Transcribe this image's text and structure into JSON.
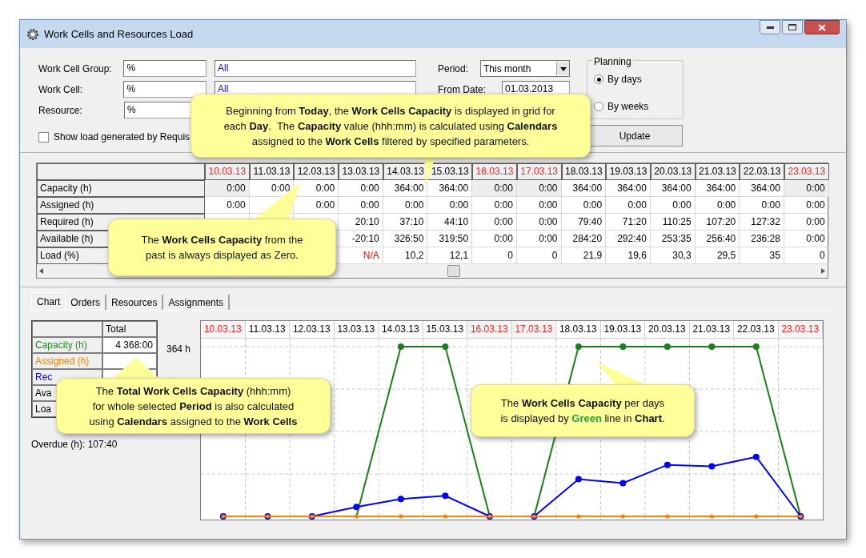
{
  "window": {
    "title": "Work Cells and Resources Load"
  },
  "filters": [
    {
      "label": "Work Cell Group:",
      "code": "%",
      "name": "All"
    },
    {
      "label": "Work Cell:",
      "code": "%",
      "name": "All"
    },
    {
      "label": "Resource:",
      "code": "%"
    }
  ],
  "requisitions_checkbox": {
    "label": "Show load generated by Requis",
    "checked": false
  },
  "period": {
    "label": "Period:",
    "value": "This month"
  },
  "from_date": {
    "label": "From Date:",
    "value": "01.03.2013"
  },
  "planning": {
    "title": "Planning",
    "options": [
      {
        "label": "By days",
        "selected": true
      },
      {
        "label": "By weeks",
        "selected": false
      }
    ]
  },
  "update_button": "Update",
  "grid": {
    "dates": [
      {
        "label": "10.03.13",
        "weekend": true
      },
      {
        "label": "11.03.13",
        "weekend": false
      },
      {
        "label": "12.03.13",
        "weekend": false
      },
      {
        "label": "13.03.13",
        "weekend": false
      },
      {
        "label": "14.03.13",
        "weekend": false
      },
      {
        "label": "15.03.13",
        "weekend": false
      },
      {
        "label": "16.03.13",
        "weekend": true
      },
      {
        "label": "17.03.13",
        "weekend": true
      },
      {
        "label": "18.03.13",
        "weekend": false
      },
      {
        "label": "19.03.13",
        "weekend": false
      },
      {
        "label": "20.03.13",
        "weekend": false
      },
      {
        "label": "21.03.13",
        "weekend": false
      },
      {
        "label": "22.03.13",
        "weekend": false
      },
      {
        "label": "23.03.13",
        "weekend": true
      }
    ],
    "rows": [
      {
        "label": "Capacity (h)",
        "cells": [
          {
            "text": "0:00",
            "alert": false
          },
          {
            "text": "0:00",
            "alert": false
          },
          {
            "text": "0:00",
            "alert": false
          },
          {
            "text": "0:00",
            "alert": false
          },
          {
            "text": "364:00",
            "alert": false
          },
          {
            "text": "364:00",
            "alert": false
          },
          {
            "text": "0:00",
            "alert": false
          },
          {
            "text": "0:00",
            "alert": false
          },
          {
            "text": "364:00",
            "alert": false
          },
          {
            "text": "364:00",
            "alert": false
          },
          {
            "text": "364:00",
            "alert": false
          },
          {
            "text": "364:00",
            "alert": false
          },
          {
            "text": "364:00",
            "alert": false
          },
          {
            "text": "0:00",
            "alert": false
          }
        ]
      },
      {
        "label": "Assigned (h)",
        "cells": [
          {
            "text": "0:00",
            "alert": false
          },
          null,
          {
            "text": "0:00",
            "alert": false
          },
          {
            "text": "0:00",
            "alert": false
          },
          {
            "text": "0:00",
            "alert": false
          },
          {
            "text": "0:00",
            "alert": false
          },
          {
            "text": "0:00",
            "alert": false
          },
          {
            "text": "0:00",
            "alert": false
          },
          {
            "text": "0:00",
            "alert": false
          },
          {
            "text": "0:00",
            "alert": false
          },
          {
            "text": "0:00",
            "alert": false
          },
          {
            "text": "0:00",
            "alert": false
          },
          {
            "text": "0:00",
            "alert": false
          },
          {
            "text": "0:00",
            "alert": false
          }
        ]
      },
      {
        "label": "Required (h)",
        "cells": [
          null,
          null,
          null,
          {
            "text": "20:10",
            "alert": false
          },
          {
            "text": "37:10",
            "alert": false
          },
          {
            "text": "44:10",
            "alert": false
          },
          {
            "text": "0:00",
            "alert": false
          },
          {
            "text": "0:00",
            "alert": false
          },
          {
            "text": "79:40",
            "alert": false
          },
          {
            "text": "71:20",
            "alert": false
          },
          {
            "text": "110:25",
            "alert": false
          },
          {
            "text": "107:20",
            "alert": false
          },
          {
            "text": "127:32",
            "alert": false
          },
          {
            "text": "0:00",
            "alert": false
          }
        ]
      },
      {
        "label": "Available (h)",
        "cells": [
          null,
          null,
          null,
          {
            "text": "-20:10",
            "alert": false
          },
          {
            "text": "326:50",
            "alert": false
          },
          {
            "text": "319:50",
            "alert": false
          },
          {
            "text": "0:00",
            "alert": false
          },
          {
            "text": "0:00",
            "alert": false
          },
          {
            "text": "284:20",
            "alert": false
          },
          {
            "text": "292:40",
            "alert": false
          },
          {
            "text": "253:35",
            "alert": false
          },
          {
            "text": "256:40",
            "alert": false
          },
          {
            "text": "236:28",
            "alert": false
          },
          {
            "text": "0:00",
            "alert": false
          }
        ]
      },
      {
        "label": "Load (%)",
        "cells": [
          null,
          null,
          null,
          {
            "text": "N/A",
            "alert": true
          },
          {
            "text": "10,2",
            "alert": false
          },
          {
            "text": "12,1",
            "alert": false
          },
          {
            "text": "0",
            "alert": false
          },
          {
            "text": "0",
            "alert": false
          },
          {
            "text": "21,9",
            "alert": false
          },
          {
            "text": "19,6",
            "alert": false
          },
          {
            "text": "30,3",
            "alert": false
          },
          {
            "text": "29,5",
            "alert": false
          },
          {
            "text": "35",
            "alert": false
          },
          {
            "text": "0",
            "alert": false
          }
        ]
      }
    ]
  },
  "tabs": [
    {
      "label": "Chart",
      "selected": true
    },
    {
      "label": "Orders",
      "selected": false
    },
    {
      "label": "Resources",
      "selected": false
    },
    {
      "label": "Assignments",
      "selected": false
    }
  ],
  "totals": {
    "header": "Total",
    "rows": [
      {
        "label": "Capacity (h)",
        "value": "4 368:00",
        "color": "#228b22"
      },
      {
        "label": "Assigned (h)",
        "color": "#ff8000"
      },
      {
        "label": "Rec",
        "color": "#0000ff"
      },
      {
        "label": "Ava",
        "color": "#000000"
      },
      {
        "label": "Loa",
        "color": "#000000"
      }
    ]
  },
  "axis_top_label": "364 h",
  "overdue": "Overdue (h): 107:40",
  "chart": {
    "dates": [
      {
        "label": "10.03.13",
        "weekend": true
      },
      {
        "label": "11.03.13",
        "weekend": false
      },
      {
        "label": "12.03.13",
        "weekend": false
      },
      {
        "label": "13.03.13",
        "weekend": false
      },
      {
        "label": "14.03.13",
        "weekend": false
      },
      {
        "label": "15.03.13",
        "weekend": false
      },
      {
        "label": "16.03.13",
        "weekend": true
      },
      {
        "label": "17.03.13",
        "weekend": true
      },
      {
        "label": "18.03.13",
        "weekend": false
      },
      {
        "label": "19.03.13",
        "weekend": false
      },
      {
        "label": "20.03.13",
        "weekend": false
      },
      {
        "label": "21.03.13",
        "weekend": false
      },
      {
        "label": "22.03.13",
        "weekend": false
      },
      {
        "label": "23.03.13",
        "weekend": true
      }
    ]
  },
  "callouts": [
    {
      "lines": [
        [
          {
            "text": "Beginning from **Today**, the **Work Cells Capacity** is displayed in grid for",
            "accent": false
          }
        ],
        [
          {
            "text": "each **Day**.  The **Capacity** value (hhh:mm) is calculated using **Calendars**",
            "accent": false
          }
        ],
        [
          {
            "text": "assigned to the **Work Cells** filtered by specified parameters.",
            "accent": false
          }
        ]
      ]
    },
    {
      "lines": [
        [
          {
            "text": "The **Work Cells Capacity** from the",
            "accent": false
          }
        ],
        [
          {
            "text": "past is always displayed as Zero.",
            "accent": false
          }
        ]
      ]
    },
    {
      "lines": [
        [
          {
            "text": "The **Total Work Cells Capacity** (hhh:mm)",
            "accent": false
          }
        ],
        [
          {
            "text": "for whole selected **Period** is also calculated",
            "accent": false
          }
        ],
        [
          {
            "text": "using **Calendars** assigned to the **Work Cells**",
            "accent": false
          }
        ]
      ]
    },
    {
      "lines": [
        [
          {
            "text": "The **Work Cells Capacity** per days",
            "accent": false
          }
        ],
        [
          {
            "text": "is displayed by ",
            "accent": false
          },
          {
            "text": "Green",
            "accent": true
          },
          {
            "text": " line in **Chart**.",
            "accent": false
          }
        ]
      ]
    }
  ]
}
